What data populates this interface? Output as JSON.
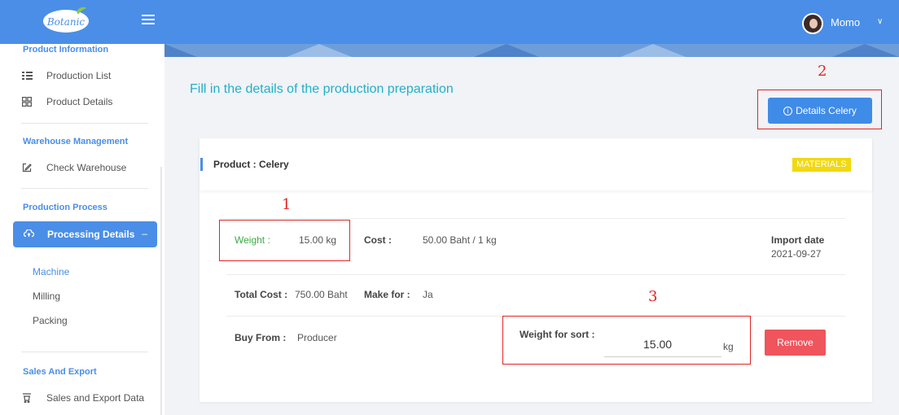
{
  "colors": {
    "primary": "#4a8ee8",
    "title": "#22b0c7",
    "badge": "#f2d811",
    "danger": "#f0545c",
    "annotation": "#e32424",
    "weight_label": "#3aab43"
  },
  "header": {
    "logo_text": "Botanic",
    "menu_icon": "hamburger-icon",
    "user": {
      "name": "Momo",
      "caret_icon": "chevron-down-icon"
    }
  },
  "sidebar": {
    "sections": [
      {
        "title": "Product Information",
        "items": [
          {
            "label": "Production List",
            "icon": "list-icon"
          },
          {
            "label": "Product Details",
            "icon": "grid-icon"
          }
        ]
      },
      {
        "title": "Warehouse Management",
        "items": [
          {
            "label": "Check Warehouse",
            "icon": "edit-icon"
          }
        ]
      },
      {
        "title": "Production Process",
        "items": [
          {
            "label": "Processing Details",
            "icon": "cloud-icon",
            "active": true,
            "collapse": "–"
          }
        ],
        "sub_items": [
          "Machine",
          "Milling",
          "Packing"
        ]
      },
      {
        "title": "Sales And Export",
        "items": [
          {
            "label": "Sales and Export Data",
            "icon": "cart-icon"
          }
        ]
      }
    ]
  },
  "main": {
    "page_title": "Fill in the details of the production preparation",
    "details_button": "Details Celery",
    "card": {
      "title": "Product : Celery",
      "badge": "MATERIALS",
      "weight_label": "Weight :",
      "weight_value": "15.00 kg",
      "cost_label": "Cost :",
      "cost_value": "50.00 Baht / 1 kg",
      "import_label": "Import date",
      "import_value": "2021-09-27",
      "total_cost_label": "Total Cost :",
      "total_cost_value": "750.00 Baht",
      "make_for_label": "Make for :",
      "make_for_value": "Ja",
      "buy_from_label": "Buy From :",
      "buy_from_value": "Producer",
      "weight_sort_label": "Weight for sort :",
      "weight_sort_value": "15.00",
      "weight_sort_unit": "kg",
      "remove_button": "Remove"
    }
  },
  "annotations": [
    "1",
    "2",
    "3"
  ]
}
